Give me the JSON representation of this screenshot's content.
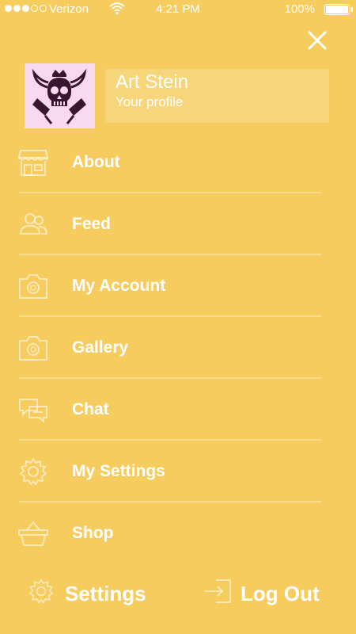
{
  "status_bar": {
    "carrier": "Verizon",
    "time": "4:21 PM",
    "battery_percent": "100%",
    "signal_bars": 3,
    "signal_total": 5
  },
  "colors": {
    "background": "#f6cc5e",
    "text": "#ffffff",
    "avatar_bg": "#f9d9ee"
  },
  "close_icon": "close-icon",
  "profile": {
    "name": "Art Stein",
    "subtitle": "Your profile",
    "avatar_icon": "skull-crown-logo"
  },
  "menu": [
    {
      "label": "About",
      "icon": "storefront-icon"
    },
    {
      "label": "Feed",
      "icon": "users-icon"
    },
    {
      "label": "My Account",
      "icon": "camera-icon"
    },
    {
      "label": "Gallery",
      "icon": "camera-icon"
    },
    {
      "label": "Chat",
      "icon": "chat-bubbles-icon"
    },
    {
      "label": "My Settings",
      "icon": "gear-icon"
    },
    {
      "label": "Shop",
      "icon": "basket-icon"
    }
  ],
  "footer": {
    "settings_label": "Settings",
    "settings_icon": "gear-icon",
    "logout_label": "Log Out",
    "logout_icon": "log-out-icon"
  }
}
